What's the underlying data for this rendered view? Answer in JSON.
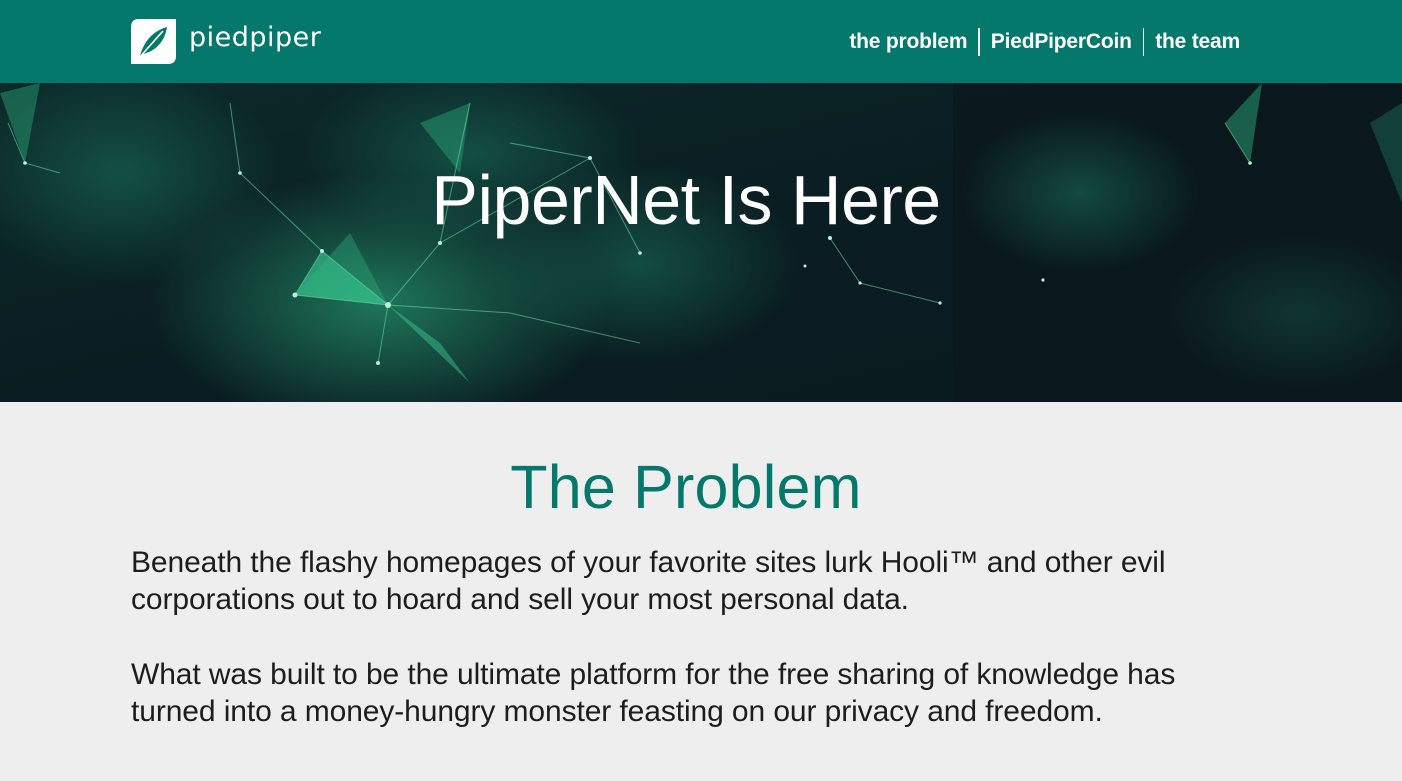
{
  "header": {
    "brand_name": "piedpiper",
    "brand_icon": "leaf-logo-icon",
    "background_color": "#04786a",
    "nav": [
      {
        "label": "the problem"
      },
      {
        "label": "PiedPiperCoin"
      },
      {
        "label": "the team"
      }
    ]
  },
  "hero": {
    "title": "PiperNet Is Here",
    "background": "dark teal network-mesh illustration"
  },
  "problem": {
    "heading": "The Problem",
    "heading_color": "#04786a",
    "paragraphs": [
      "Beneath the flashy homepages of your favorite sites lurk Hooli™ and other evil corporations out to hoard and sell your most personal data.",
      "What was built to be the ultimate platform for the free sharing of knowledge has turned into a money-hungry monster feasting on our privacy and freedom."
    ]
  }
}
